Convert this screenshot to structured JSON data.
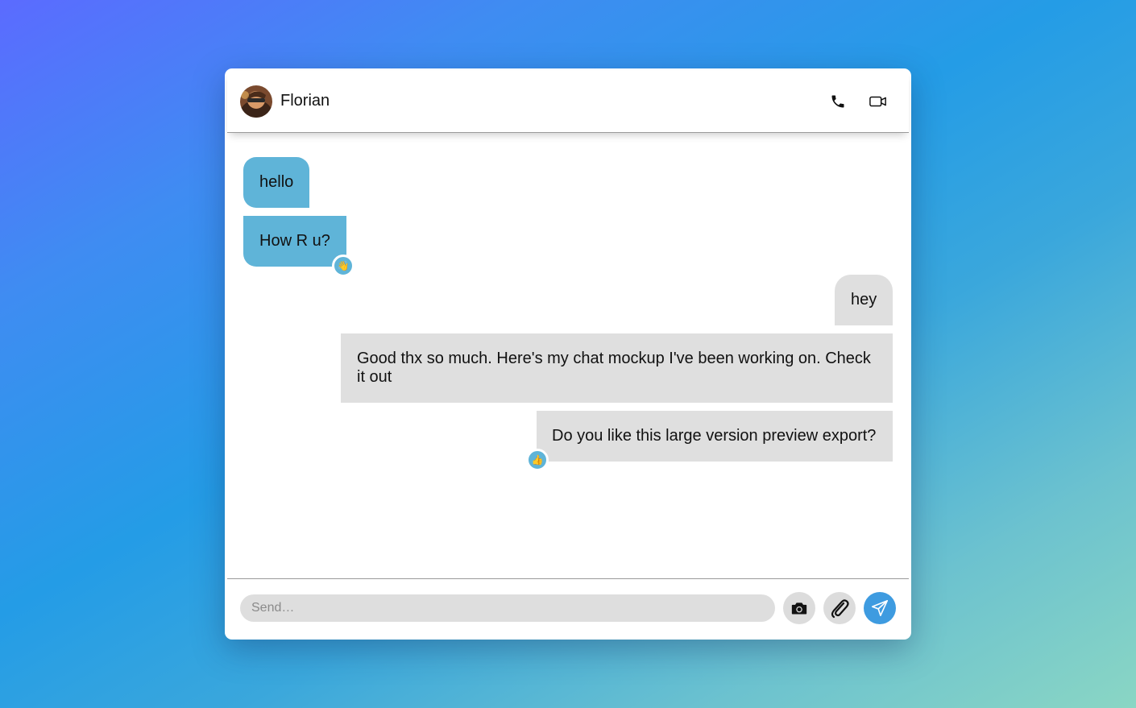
{
  "header": {
    "contact_name": "Florian",
    "avatar_icon": "user-avatar",
    "call_icon": "phone-icon",
    "video_icon": "video-camera-icon"
  },
  "messages": [
    {
      "direction": "incoming",
      "text": "hello"
    },
    {
      "direction": "incoming",
      "text": "How R u?",
      "reaction": "👋"
    },
    {
      "direction": "outgoing",
      "text": "hey"
    },
    {
      "direction": "outgoing",
      "text": "Good thx so much. Here's my chat mockup I've been working on. Check it out"
    },
    {
      "direction": "outgoing",
      "text": "Do you like this large version preview export?",
      "reaction": "👍"
    }
  ],
  "composer": {
    "placeholder": "Send…",
    "value": "",
    "camera_icon": "camera-icon",
    "attach_icon": "paperclip-icon",
    "send_icon": "paper-plane-icon"
  },
  "colors": {
    "incoming_bubble": "#5fb4d8",
    "outgoing_bubble": "#dfdfdf",
    "send_button": "#3e9be0"
  }
}
